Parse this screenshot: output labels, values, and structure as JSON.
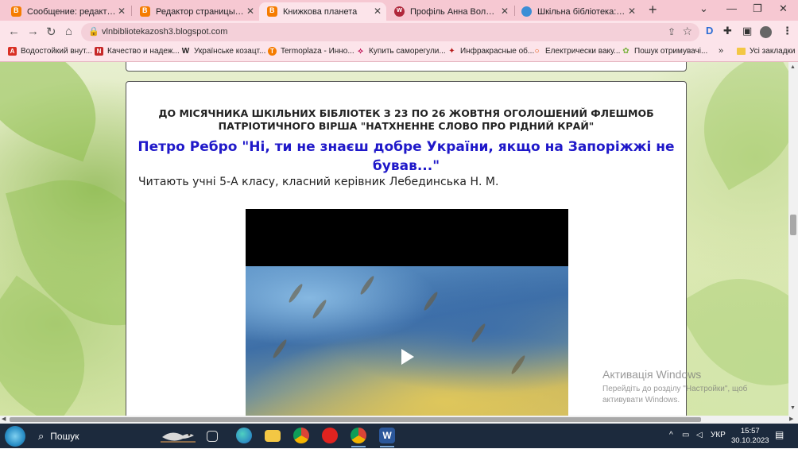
{
  "tabs": [
    {
      "label": "Сообщение: редактирован",
      "icon": "blogger-icon"
    },
    {
      "label": "Редактор страницы: предв",
      "icon": "blogger-icon"
    },
    {
      "label": "Книжкова планета",
      "icon": "blogger-icon",
      "active": true
    },
    {
      "label": "Профіль Анна Володимирі",
      "icon": "vk-icon"
    },
    {
      "label": "Шкільна бібліотека: свідок",
      "icon": "globe-icon"
    }
  ],
  "address_bar": {
    "url": "vlnbibliotekazosh3.blogspot.com"
  },
  "bookmarks": [
    {
      "label": "Водостойкий внут...",
      "color": "#d93025",
      "glyph": "A"
    },
    {
      "label": "Качество и надеж...",
      "color": "#c62828",
      "glyph": "N"
    },
    {
      "label": "Українське козацт...",
      "color": "#222222",
      "glyph": "W"
    },
    {
      "label": "Termoplaza - Инно...",
      "color": "#f57c00",
      "glyph": "T"
    },
    {
      "label": "Купить саморегули...",
      "color": "#c2185b",
      "glyph": "⟡"
    },
    {
      "label": "Инфракрасные об...",
      "color": "#b71c1c",
      "glyph": "✦"
    },
    {
      "label": "Електрически ваку...",
      "color": "#e65100",
      "glyph": "○"
    },
    {
      "label": "Пошук отримувачі...",
      "color": "#7cb342",
      "glyph": "✿"
    }
  ],
  "bookmarks_more": "»",
  "bookmarks_all": "Усі закладки",
  "post": {
    "heading": "ДО МІСЯЧНИКА ШКІЛЬНИХ БІБЛІОТЕК З 23 ПО 26 ЖОВТНЯ  ОГОЛОШЕНИЙ ФЛЕШМОБ ПАТРІОТИЧНОГО ВІРША \"НАТХНЕННЕ СЛОВО ПРО РІДНИЙ КРАЙ\"",
    "subtitle": "Петро Ребро \"Ні, ти не знаєш добре України, якщо на Запоріжжі не бував...\"",
    "readers": "Читають учні 5-А класу, класний керівник Лебединська Н. М."
  },
  "watermark": {
    "title": "Активація Windows",
    "line1": "Перейдіть до розділу \"Настройки\", щоб",
    "line2": "активувати Windows."
  },
  "taskbar": {
    "search_label": "Пошук",
    "language": "УКР",
    "time": "15:57",
    "date": "30.10.2023"
  },
  "colors": {
    "tabstrip": "#f6c8d2",
    "toolbar": "#fce4ea",
    "subtitle": "#1f18c9",
    "taskbar": "#1c2a3d"
  }
}
